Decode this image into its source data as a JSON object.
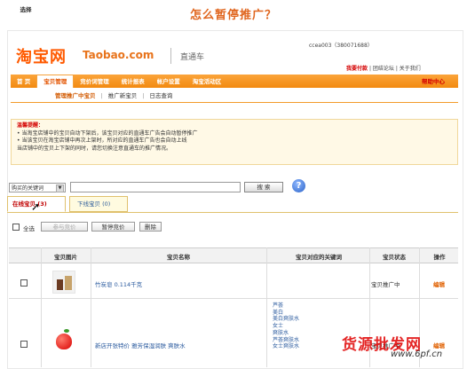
{
  "heading": "怎么暂停推广？",
  "header": {
    "logo_cn": "淘宝网",
    "logo_en": "Taobao.com",
    "subtitle": "直通车",
    "user": "ccea003（380071688）",
    "links": [
      "我要付款",
      "团结论坛",
      "关于我们"
    ]
  },
  "nav": {
    "items": [
      "首 页",
      "宝贝管理",
      "竞价词管理",
      "统计报表",
      "帐户设置",
      "淘宝活动区"
    ],
    "active_index": 1,
    "help": "帮助中心"
  },
  "subnav": [
    "管理推广中宝贝",
    "推广新宝贝",
    "日志查询"
  ],
  "tips": {
    "title": "温馨提醒：",
    "lines": [
      "• 当淘宝店铺中的宝贝自动下架后，该宝贝对应的直通车广告会自动暂停推广",
      "• 当该宝贝在淘宝店铺中再次上架时，所对应的直通车广告也会自动上线",
      "当店铺中的宝贝上下架的同时，请您切换注意直通车的推广情况。"
    ]
  },
  "search": {
    "select_value": "购买的关键词",
    "button": "搜 索"
  },
  "tabs": [
    {
      "label": "在线宝贝",
      "count": "(3)"
    },
    {
      "label": "下线宝贝",
      "count": "(0)"
    }
  ],
  "actions": {
    "select_all": "全选",
    "set_price": "参与竞价",
    "pause": "暂停竞价",
    "delete": "删除"
  },
  "table": {
    "headers": [
      "选择",
      "宝贝图片",
      "宝贝名称",
      "宝贝对应的关键词",
      "宝贝状态",
      "操作"
    ],
    "rows": [
      {
        "name": "竹炭皂 0.114千克",
        "status": "宝贝推广中",
        "action": "编辑",
        "keywords": []
      },
      {
        "name": "新店开张特价 雅芳保湿润肤 爽肤水",
        "status": "宝贝推广中",
        "action": "编辑",
        "keywords": [
          "芦荟",
          "美白",
          "美白爽肤水",
          "女士",
          "爽肤水",
          "芦荟爽肤水",
          "女士爽肤水"
        ]
      }
    ]
  },
  "watermark": {
    "cn": "货源批发网",
    "url": "www.6pf.cn"
  }
}
